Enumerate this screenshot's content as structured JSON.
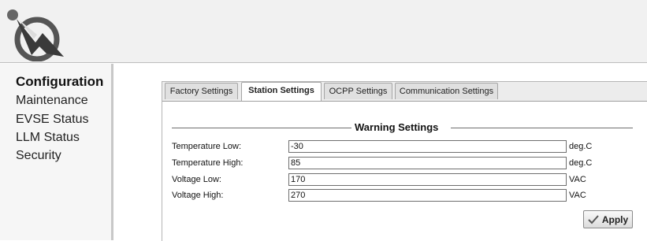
{
  "sidebar": {
    "items": [
      {
        "label": "Configuration"
      },
      {
        "label": "Maintenance"
      },
      {
        "label": "EVSE Status"
      },
      {
        "label": "LLM Status"
      },
      {
        "label": "Security"
      }
    ]
  },
  "tabs": [
    {
      "label": "Factory Settings"
    },
    {
      "label": "Station Settings"
    },
    {
      "label": "OCPP Settings"
    },
    {
      "label": "Communication Settings"
    }
  ],
  "warning_settings": {
    "legend": "Warning Settings",
    "fields": [
      {
        "label": "Temperature Low:",
        "value": "-30",
        "unit": "deg.C"
      },
      {
        "label": "Temperature High:",
        "value": "85",
        "unit": "deg.C"
      },
      {
        "label": "Voltage Low:",
        "value": "170",
        "unit": "VAC"
      },
      {
        "label": "Voltage High:",
        "value": "270",
        "unit": "VAC"
      }
    ]
  },
  "apply_label": "Apply",
  "icons": {
    "logo": "lightning-logo-icon",
    "apply": "checkmark-icon"
  }
}
